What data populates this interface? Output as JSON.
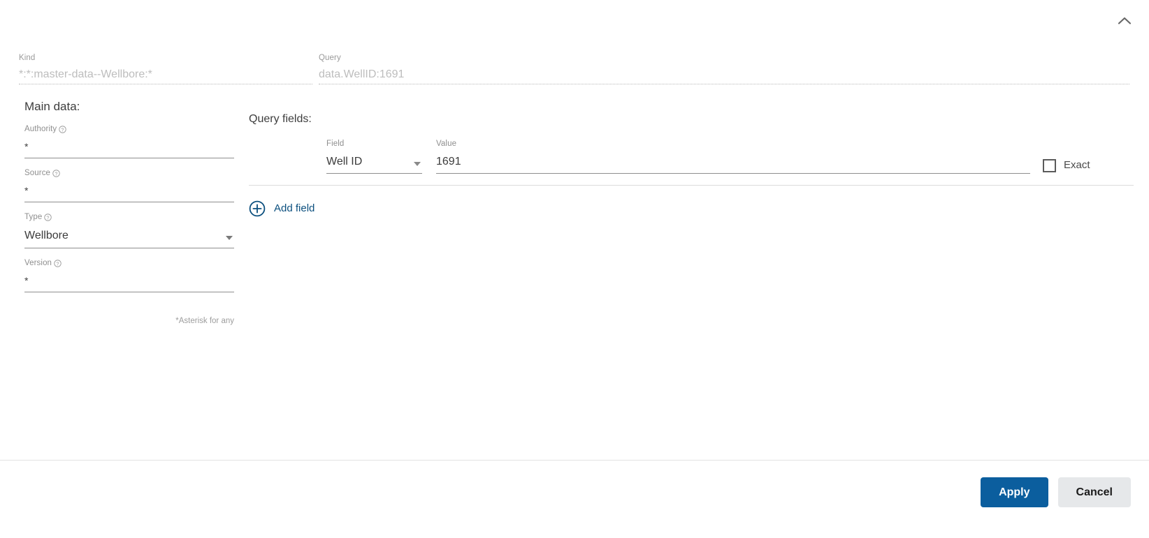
{
  "header": {
    "collapse_icon": "chevron-up-icon"
  },
  "top_fields": {
    "kind": {
      "label": "Kind",
      "value": "*:*:master-data--Wellbore:*"
    },
    "query": {
      "label": "Query",
      "value": "data.WellID:1691"
    }
  },
  "main_data": {
    "title": "Main data:",
    "help_icon": "help-circle-icon",
    "fields": [
      {
        "label": "Authority",
        "value": "*",
        "type": "text"
      },
      {
        "label": "Source",
        "value": "*",
        "type": "text"
      },
      {
        "label": "Type",
        "value": "Wellbore",
        "type": "select"
      },
      {
        "label": "Version",
        "value": "*",
        "type": "text"
      }
    ],
    "note": "*Asterisk for any"
  },
  "query_fields": {
    "title": "Query fields:",
    "column_labels": {
      "field": "Field",
      "value": "Value"
    },
    "rows": [
      {
        "field": "Well ID",
        "value": "1691",
        "exact_label": "Exact",
        "exact_checked": false
      }
    ],
    "add_field": {
      "label": "Add field",
      "icon": "plus-circle-icon"
    }
  },
  "footer": {
    "apply_label": "Apply",
    "cancel_label": "Cancel"
  },
  "colors": {
    "primary": "#0b5e9e",
    "secondary": "#e6e8ea",
    "link": "#0b4f7e",
    "label": "#8e8e8e",
    "readonly": "#bdbdbd"
  }
}
